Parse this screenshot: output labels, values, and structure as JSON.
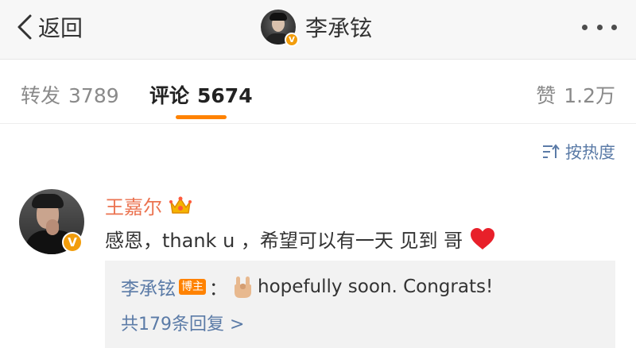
{
  "header": {
    "back_label": "返回",
    "title": "李承铉",
    "verified_mark": "V"
  },
  "tabs": [
    {
      "label": "转发",
      "count": "3789"
    },
    {
      "label": "评论",
      "count": "5674"
    },
    {
      "label": "赞",
      "count": "1.2万"
    }
  ],
  "sort": {
    "label": "按热度",
    "icon": "sort-icon"
  },
  "comment": {
    "author": "王嘉尔",
    "author_badge_icon": "crown-icon",
    "verified_mark": "V",
    "text": "感恩，thank u ，希望可以有一天 见到 哥",
    "emoji_icon": "heart-icon",
    "reply": {
      "author": "李承铉",
      "badge": "博主",
      "separator": "：",
      "emoji_icon": "rock-hand-icon",
      "text": "hopefully soon.  Congrats!"
    },
    "reply_count_text": "共179条回复 >"
  },
  "colors": {
    "accent": "#ff8200",
    "link": "#5b7ba7",
    "name": "#eb7350",
    "header_bg": "#f7f7f7",
    "reply_bg": "#f2f2f2"
  }
}
